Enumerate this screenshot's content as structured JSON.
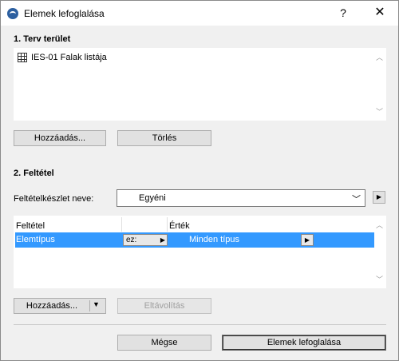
{
  "window": {
    "title": "Elemek lefoglalása",
    "help_label": "?",
    "close_label": "✕"
  },
  "section1": {
    "title": "1. Terv terület",
    "items": [
      {
        "icon": "grid-table-icon",
        "label": "IES-01 Falak listája"
      }
    ],
    "add_button": "Hozzáadás...",
    "delete_button": "Törlés"
  },
  "section2": {
    "title": "2. Feltétel",
    "criteria_set_label": "Feltételkészlet neve:",
    "criteria_set_value": "Egyéni",
    "table": {
      "headers": [
        "Feltétel",
        "",
        "Érték"
      ],
      "rows": [
        {
          "criterion": "Elemtípus",
          "operator": "ez:",
          "value": "Minden típus"
        }
      ]
    },
    "add_button": "Hozzáadás...",
    "remove_button": "Eltávolítás"
  },
  "footer": {
    "cancel_button": "Mégse",
    "ok_button": "Elemek lefoglalása"
  }
}
